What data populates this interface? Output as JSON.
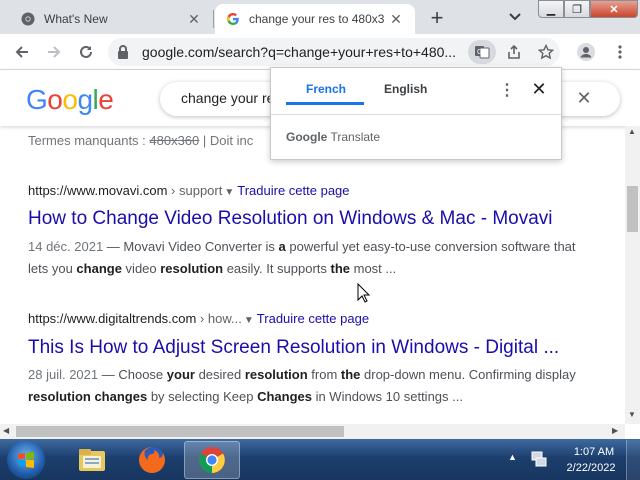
{
  "browser": {
    "tabs": [
      {
        "title": "What's New",
        "icon": "chrome-icon"
      },
      {
        "title": "change your res to 480x3",
        "icon": "google-g-icon"
      }
    ],
    "new_tab_symbol": "+",
    "url": "google.com/search?q=change+your+res+to+480..."
  },
  "search": {
    "logo": [
      "G",
      "o",
      "o",
      "g",
      "l",
      "e"
    ],
    "logo_colors": [
      "#4285F4",
      "#EA4335",
      "#FBBC05",
      "#4285F4",
      "#34A853",
      "#EA4335"
    ],
    "query": "change your re"
  },
  "results": {
    "missing_label": "Termes manquants : ",
    "missing_term": "480x360",
    "missing_suffix": " | Doit inc",
    "items": [
      {
        "cite_domain": "https://www.movavi.com",
        "cite_path": " › support",
        "translate": "Traduire cette page",
        "title": "How to Change Video Resolution on Windows & Mac - Movavi",
        "date": "14 déc. 2021",
        "snippet": [
          {
            "t": " — Movavi Video Converter is ",
            "b": false
          },
          {
            "t": "a",
            "b": true
          },
          {
            "t": " powerful yet easy-to-use conversion software that",
            "b": false
          }
        ],
        "snippet2": [
          {
            "t": "lets you ",
            "b": false
          },
          {
            "t": "change",
            "b": true
          },
          {
            "t": " video ",
            "b": false
          },
          {
            "t": "resolution",
            "b": true
          },
          {
            "t": " easily. It supports ",
            "b": false
          },
          {
            "t": "the",
            "b": true
          },
          {
            "t": " most ...",
            "b": false
          }
        ]
      },
      {
        "cite_domain": "https://www.digitaltrends.com",
        "cite_path": " › how...",
        "translate": "Traduire cette page",
        "title": "This Is How to Adjust Screen Resolution in Windows - Digital ...",
        "date": "28 juil. 2021",
        "snippet": [
          {
            "t": " — Choose ",
            "b": false
          },
          {
            "t": "your",
            "b": true
          },
          {
            "t": " desired ",
            "b": false
          },
          {
            "t": "resolution",
            "b": true
          },
          {
            "t": " from ",
            "b": false
          },
          {
            "t": "the",
            "b": true
          },
          {
            "t": " drop-down menu. Confirming display",
            "b": false
          }
        ],
        "snippet2": [
          {
            "t": "resolution changes",
            "b": true
          },
          {
            "t": " by selecting Keep ",
            "b": false
          },
          {
            "t": "Changes",
            "b": true
          },
          {
            "t": " in Windows 10 settings ...",
            "b": false
          }
        ]
      }
    ]
  },
  "translate_popup": {
    "tab_source": "French",
    "tab_target": "English",
    "brand_google": "Google",
    "brand_translate": " Translate"
  },
  "taskbar": {
    "apps": [
      "windows-explorer-icon",
      "firefox-icon",
      "chrome-icon"
    ],
    "time": "1:07 AM",
    "date": "2/22/2022"
  }
}
